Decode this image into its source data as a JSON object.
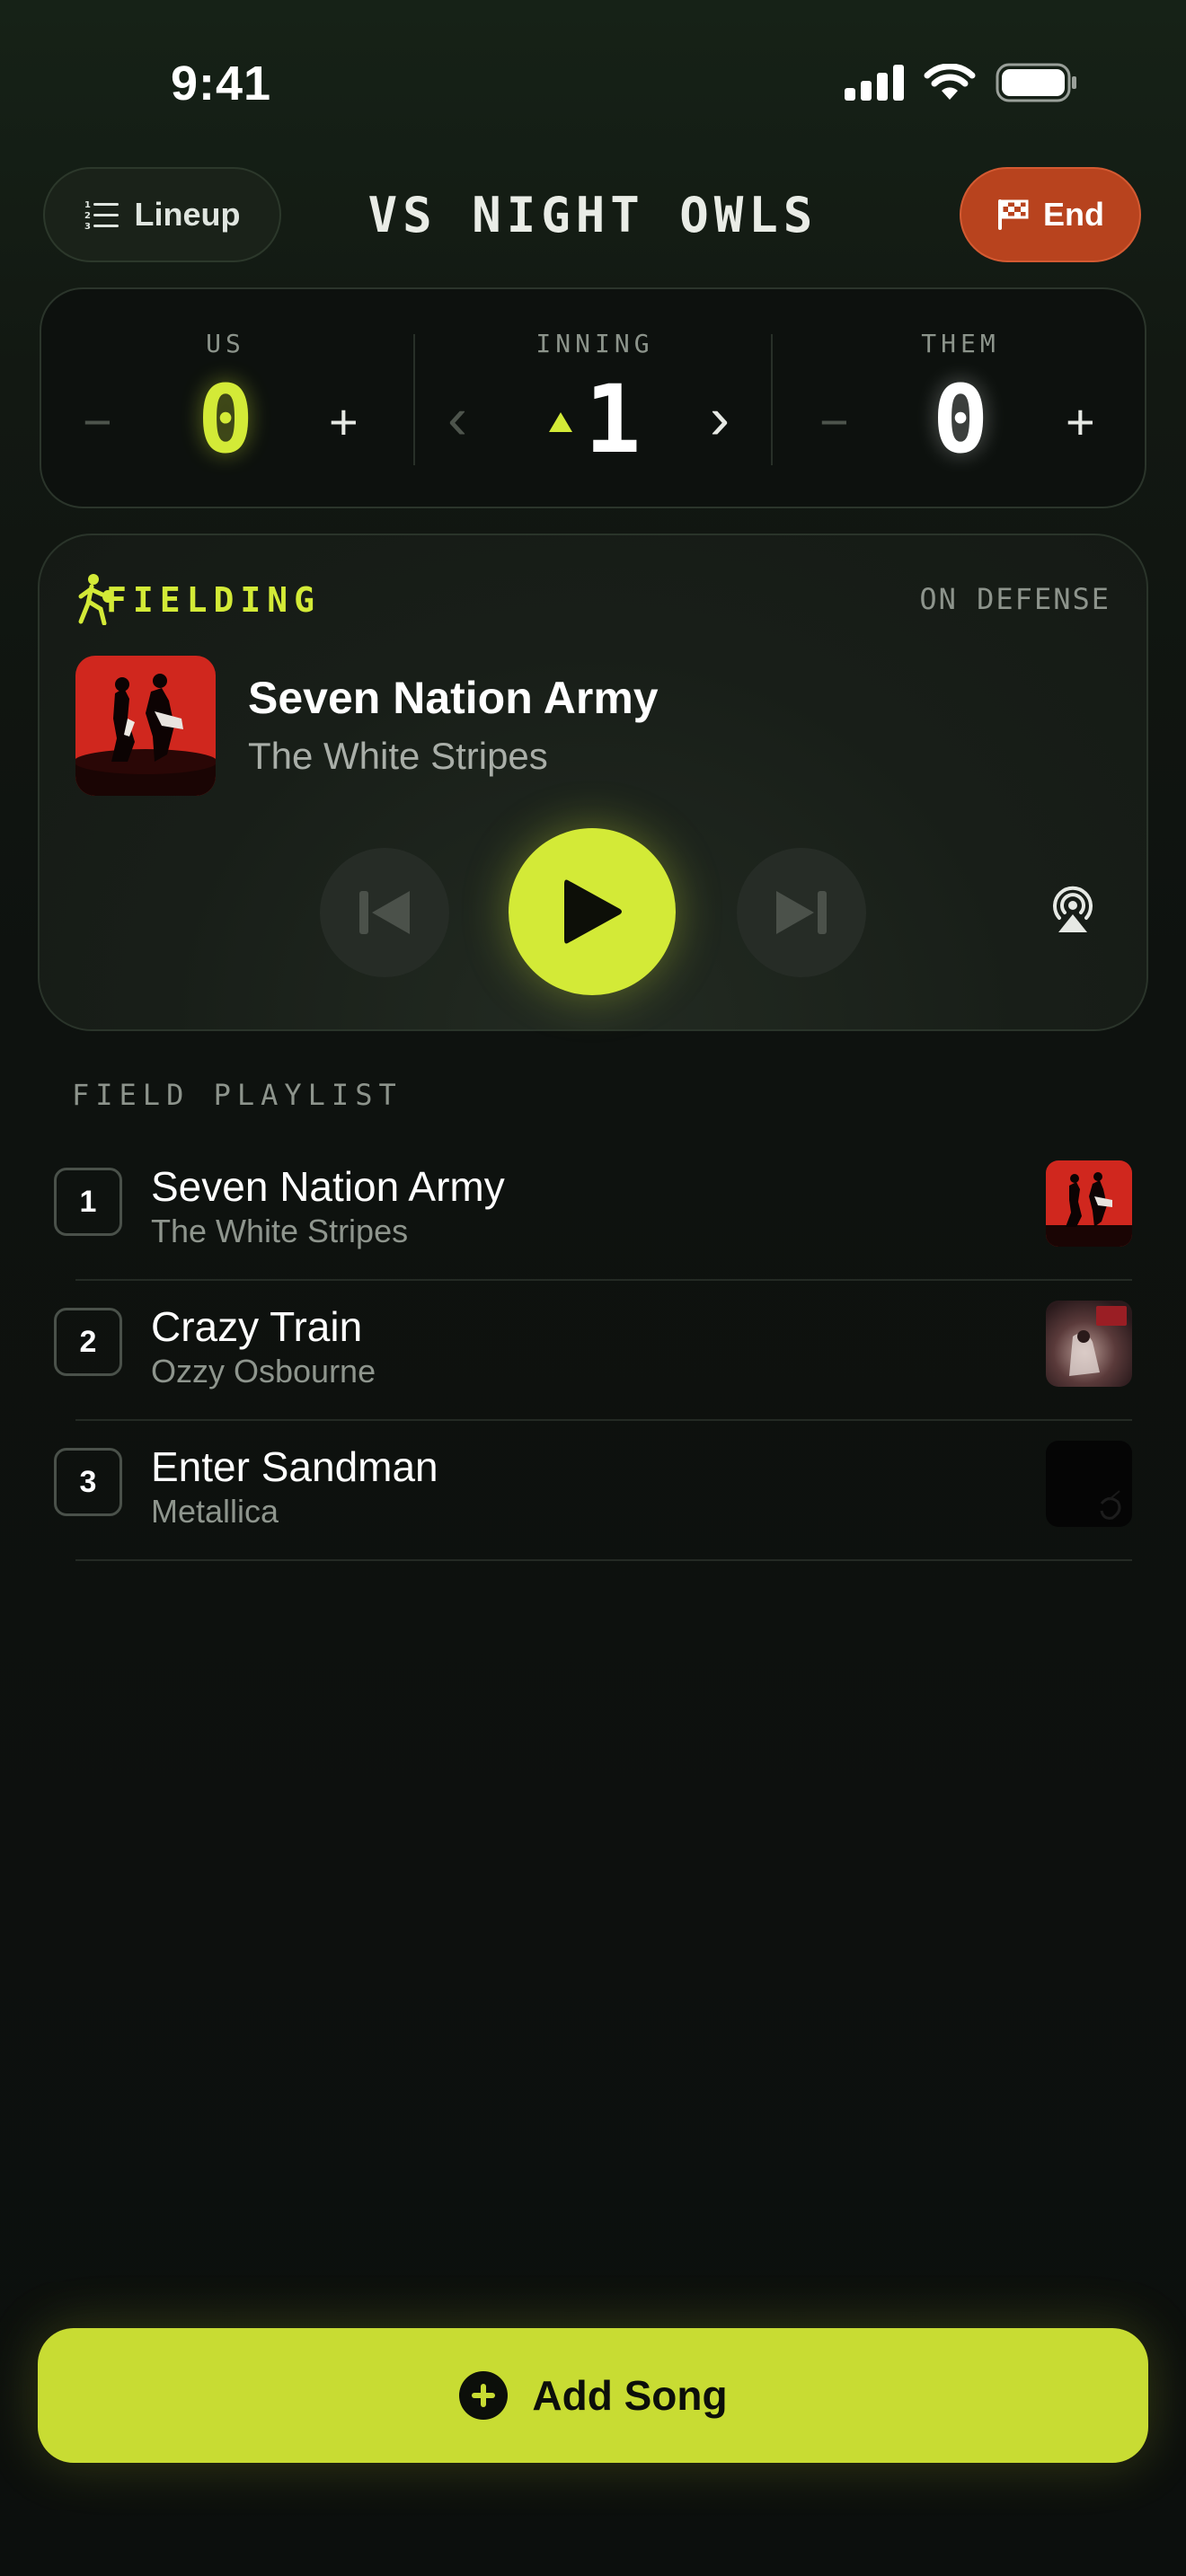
{
  "status": {
    "time": "9:41"
  },
  "header": {
    "lineup_label": "Lineup",
    "title": "VS NIGHT OWLS",
    "end_label": "End"
  },
  "score": {
    "us": {
      "label": "US",
      "value": "0",
      "minus": "−",
      "plus": "+"
    },
    "inning": {
      "label": "INNING",
      "value": "1",
      "half": "top",
      "prev": "‹",
      "next": "›"
    },
    "them": {
      "label": "THEM",
      "value": "0",
      "minus": "−",
      "plus": "+"
    }
  },
  "now_playing": {
    "mode": "FIELDING",
    "status": "ON DEFENSE",
    "title": "Seven Nation Army",
    "artist": "The White Stripes",
    "is_playing": false
  },
  "playlist": {
    "label": "FIELD PLAYLIST",
    "items": [
      {
        "num": "1",
        "title": "Seven Nation Army",
        "artist": "The White Stripes"
      },
      {
        "num": "2",
        "title": "Crazy Train",
        "artist": "Ozzy Osbourne"
      },
      {
        "num": "3",
        "title": "Enter Sandman",
        "artist": "Metallica"
      }
    ]
  },
  "add_song": {
    "label": "Add Song"
  },
  "colors": {
    "accent": "#d3ea37",
    "end": "#b8431e",
    "background": "#0e120f"
  }
}
